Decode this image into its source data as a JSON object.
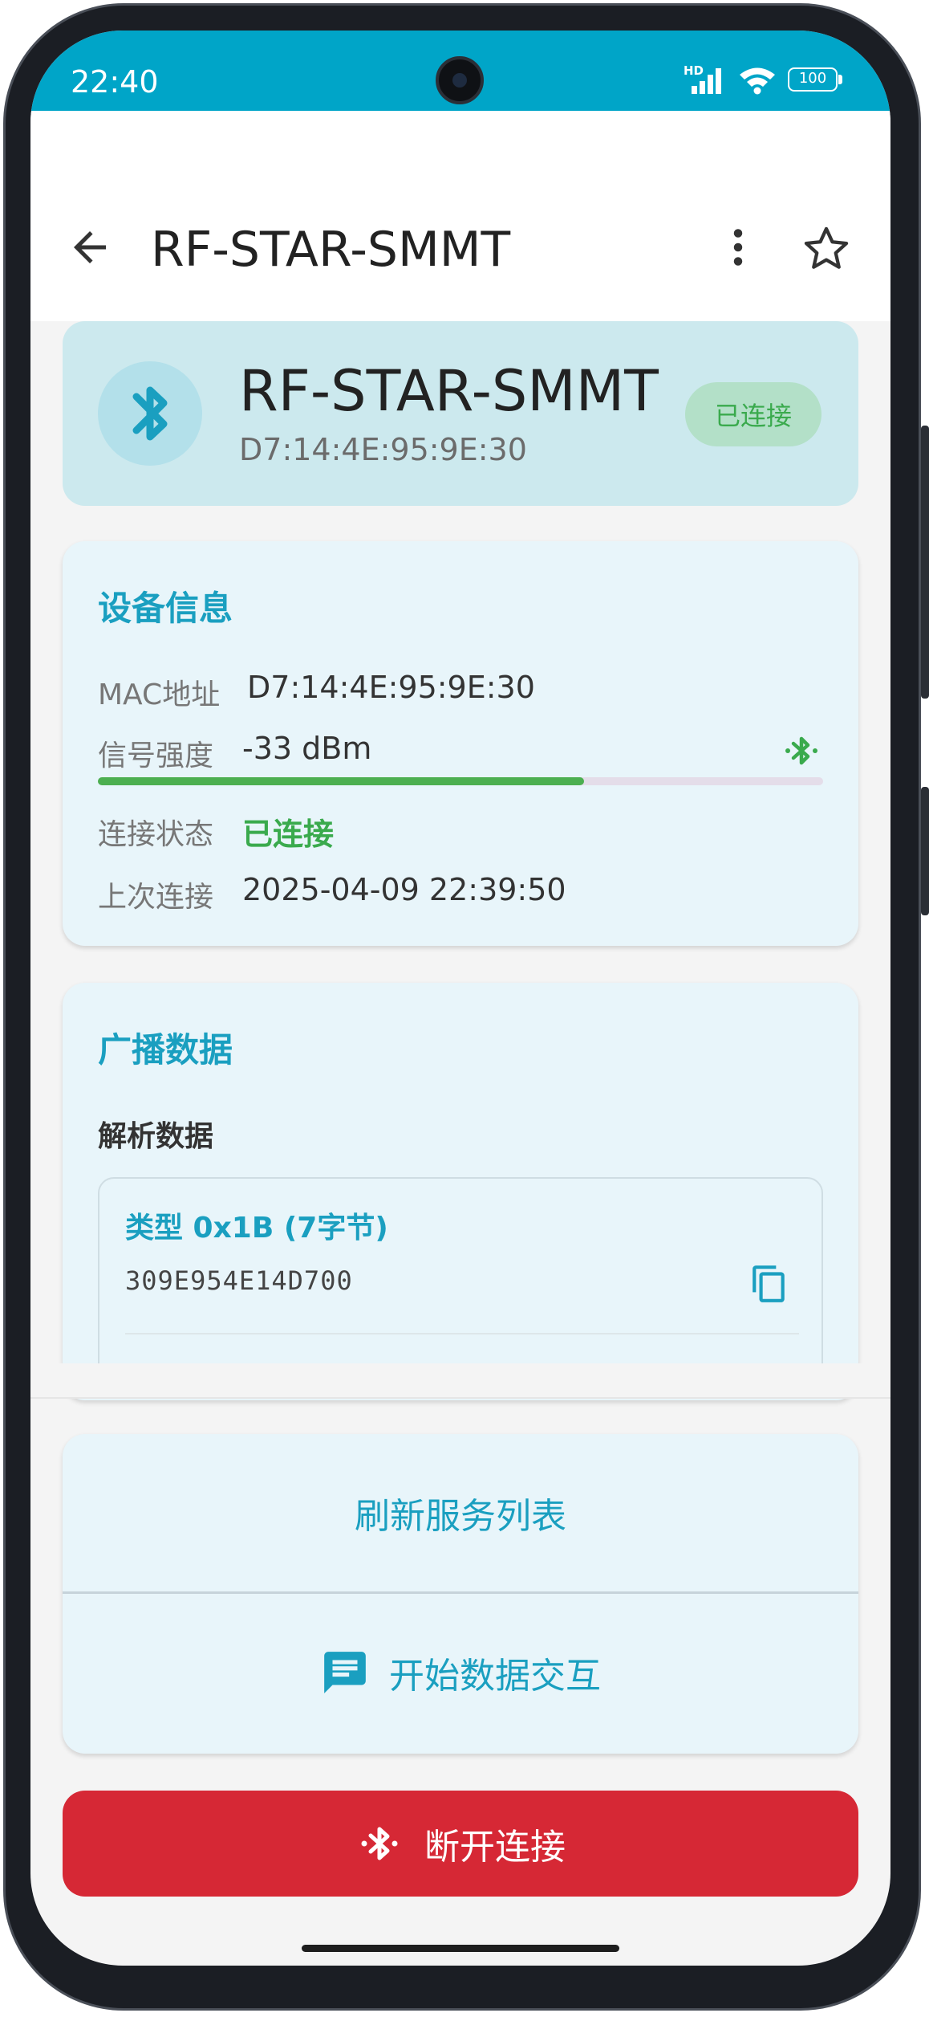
{
  "status_bar": {
    "time": "22:40",
    "network_badge": "HD",
    "battery": "100",
    "icons": [
      "signal-icon",
      "wifi-icon",
      "battery-icon"
    ]
  },
  "app_bar": {
    "title": "RF-STAR-SMMT",
    "icons": [
      "back-icon",
      "more-vert-icon",
      "star-outline-icon"
    ]
  },
  "device_header": {
    "name": "RF-STAR-SMMT",
    "mac": "D7:14:4E:95:9E:30",
    "status": "已连接",
    "icon": "bluetooth-icon"
  },
  "device_info": {
    "title": "设备信息",
    "mac_label": "MAC地址",
    "mac_value": "D7:14:4E:95:9E:30",
    "signal_label": "信号强度",
    "signal_value": "-33 dBm",
    "signal_level_fraction": 0.67,
    "connection_label": "连接状态",
    "connection_value": "已连接",
    "last_connection_label": "上次连接",
    "last_connection_value": "2025-04-09 22:39:50"
  },
  "broadcast": {
    "title": "广播数据",
    "parsed_label": "解析数据",
    "items": [
      {
        "type": "类型 0x1B (7字节)",
        "value": "309E954E14D700"
      }
    ]
  },
  "actions": {
    "refresh": "刷新服务列表",
    "interact": "开始数据交互",
    "disconnect": "断开连接"
  },
  "colors": {
    "accent": "#1a9fc0",
    "status_bar": "#00a5c8",
    "connected": "#3aaa4d",
    "danger": "#d62835"
  }
}
